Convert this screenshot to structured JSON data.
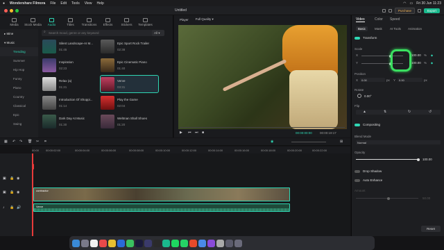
{
  "menubar": {
    "app": "Wondershare Filmora",
    "items": [
      "File",
      "Edit",
      "Tools",
      "View",
      "Help"
    ],
    "clock": "Fri 30 Jun  11:23"
  },
  "window": {
    "title": "Untitled",
    "purchase": "Purchase",
    "export": "Export"
  },
  "media_tabs": [
    "Media",
    "Stock Media",
    "Audio",
    "Titles",
    "Transitions",
    "Effects",
    "Stickers",
    "Templates"
  ],
  "sidebar": {
    "header": "Mine",
    "section": "Music",
    "items": [
      "Trending",
      "Summer",
      "Hip Hop",
      "Funny",
      "Piano",
      "Country",
      "Classical",
      "Epic",
      "Swing"
    ]
  },
  "search": {
    "placeholder": "Search mood, genre or any keyword",
    "filter": "All"
  },
  "tracks": [
    {
      "name": "Silent Landscape-AI M...",
      "dur": "01:45"
    },
    {
      "name": "Epic Sport Rock Trailer",
      "dur": "02:38"
    },
    {
      "name": "Inspiration",
      "dur": "02:23"
    },
    {
      "name": "Epic Cinematic Piano",
      "dur": "01:40"
    },
    {
      "name": "Relax (a)",
      "dur": "01:21"
    },
    {
      "name": "Verve",
      "dur": "03:31"
    },
    {
      "name": "Introduction Of Shoppi...",
      "dur": "01:14"
    },
    {
      "name": "Play the Game",
      "dur": "02:04"
    },
    {
      "name": "Dark Day At Music",
      "dur": "01:30"
    },
    {
      "name": "Weltman Shall Shoes",
      "dur": "01:20"
    }
  ],
  "player": {
    "label": "Player",
    "quality": "Full Quality",
    "current": "00:00:00:00",
    "total": "00:00:19:17"
  },
  "props": {
    "tabs": [
      "Video",
      "Color",
      "Speed"
    ],
    "subtabs": [
      "Basic",
      "Mask",
      "AI Tools",
      "Animation"
    ],
    "transform": "Transform",
    "scale": "Scale",
    "x": "X",
    "y": "Y",
    "scale_x": "100.00",
    "scale_y": "100.00",
    "pct": "%",
    "position": "Position",
    "pos_x": "0.00",
    "pos_y": "0.00",
    "px": "px",
    "rotate": "Rotate",
    "rotate_val": "0.00°",
    "flip": "Flip",
    "compositing": "Compositing",
    "blend": "Blend Mode",
    "blend_val": "Normal",
    "opacity": "Opacity",
    "opacity_val": "100.00",
    "dropshadow": "Drop Shadow",
    "autoenhance": "Auto Enhance",
    "amount": "Amount",
    "amount_val": "50.00",
    "reset": "Reset"
  },
  "timeline": {
    "ruler": [
      "00:00",
      "00:00:02:00",
      "00:00:04:00",
      "00:00:06:00",
      "00:00:08:00",
      "00:00:10:00",
      "00:00:12:00",
      "00:00:14:00",
      "00:00:16:00",
      "00:00:18:00",
      "00:00:20:00",
      "00:00:22:00",
      "00:00:24:00"
    ],
    "video_clip": "contractor",
    "audio_clip": "Verve"
  }
}
